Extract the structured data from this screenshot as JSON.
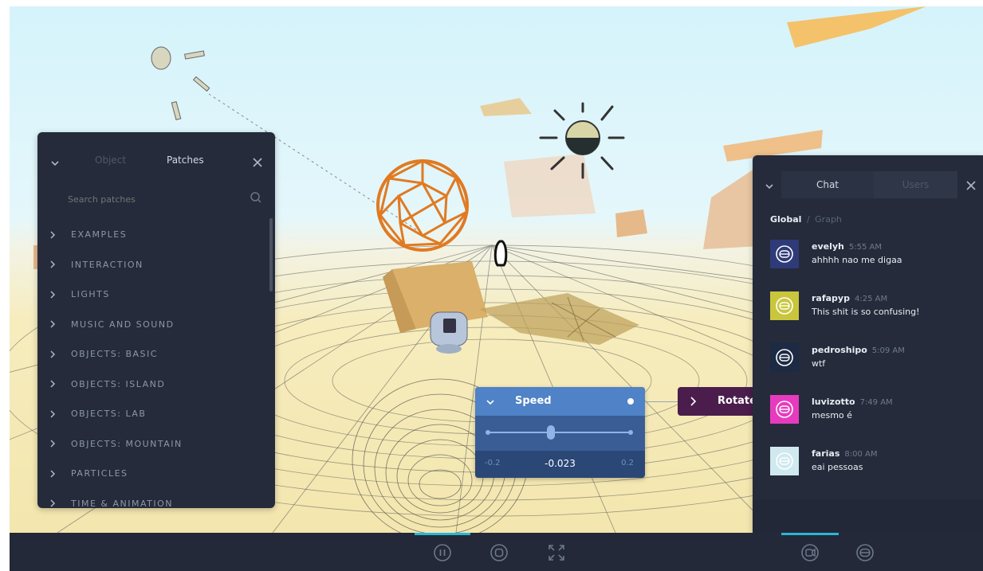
{
  "left_panel": {
    "tabs": [
      {
        "label": "Object"
      },
      {
        "label": "Patches"
      }
    ],
    "active_tab": 1,
    "search": {
      "placeholder": "Search patches",
      "value": ""
    },
    "categories": [
      {
        "label": "EXAMPLES"
      },
      {
        "label": "INTERACTION"
      },
      {
        "label": "LIGHTS"
      },
      {
        "label": "MUSIC AND SOUND"
      },
      {
        "label": "OBJECTS: BASIC"
      },
      {
        "label": "OBJECTS: ISLAND"
      },
      {
        "label": "OBJECTS: LAB"
      },
      {
        "label": "OBJECTS: MOUNTAIN"
      },
      {
        "label": "PARTICLES"
      },
      {
        "label": "TIME & ANIMATION"
      }
    ]
  },
  "speed_node": {
    "title": "Speed",
    "min": "-0.2",
    "max": "0.2",
    "value": "-0.023",
    "slider_fraction": 0.44
  },
  "rotate_node": {
    "title": "Rotate"
  },
  "chat_panel": {
    "tabs": [
      {
        "label": "Chat"
      },
      {
        "label": "Users"
      }
    ],
    "active_tab": 0,
    "scopes": {
      "active": "Global",
      "separator": "/",
      "other": "Graph"
    },
    "messages": [
      {
        "user": "evelyh",
        "time": "5:55 AM",
        "text": "ahhhh nao me digaa",
        "color": "#2f3a78"
      },
      {
        "user": "rafapyp",
        "time": "4:25 AM",
        "text": "This shit is so confusing!",
        "color": "#c9c63e"
      },
      {
        "user": "pedroshipo",
        "time": "5:09 AM",
        "text": "wtf",
        "color": "#1c2a44"
      },
      {
        "user": "luvizotto",
        "time": "7:49 AM",
        "text": "mesmo é",
        "color": "#e73bbf"
      },
      {
        "user": "farias",
        "time": "8:00 AM",
        "text": "eai pessoas",
        "color": "#cfe9ef"
      }
    ]
  },
  "colors": {
    "panel_bg": "#252b3a",
    "accent": "#29b6d8",
    "node_header": "#4f82c6",
    "node_body": "#3a5d96",
    "rotate_node": "#4a1d4c"
  },
  "icons": {
    "chevron": "chevron-down-icon",
    "close": "close-icon",
    "search": "search-icon",
    "pause": "pause-icon",
    "stop": "stop-icon",
    "fullscreen": "fullscreen-icon",
    "record": "record-icon",
    "avatar": "avatar-icon"
  }
}
